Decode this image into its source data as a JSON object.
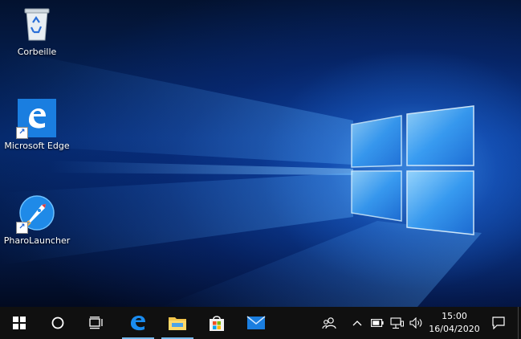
{
  "desktop": {
    "icons": [
      {
        "name": "recycle-bin",
        "label": "Corbeille"
      },
      {
        "name": "microsoft-edge",
        "label": "Microsoft Edge"
      },
      {
        "name": "pharo-launcher",
        "label": "PharoLauncher"
      }
    ]
  },
  "taskbar": {
    "start_icon": "windows-logo-icon",
    "search_icon": "cortana-circle-icon",
    "task_view_icon": "task-view-icon",
    "pinned": [
      {
        "name": "edge-icon",
        "active": true
      },
      {
        "name": "file-explorer-icon",
        "active": true
      },
      {
        "name": "store-icon",
        "active": false
      },
      {
        "name": "mail-icon",
        "active": false
      }
    ],
    "tray": {
      "people_icon": "people-icon",
      "chevron_icon": "chevron-up-icon",
      "battery_icon": "battery-icon",
      "network_icon": "network-icon",
      "volume_icon": "volume-icon",
      "time": "15:00",
      "date": "16/04/2020",
      "notification_icon": "notification-icon"
    }
  },
  "colors": {
    "taskbar": "#101010",
    "accent": "#1a7ee0",
    "active_indicator": "#76b9ed"
  }
}
